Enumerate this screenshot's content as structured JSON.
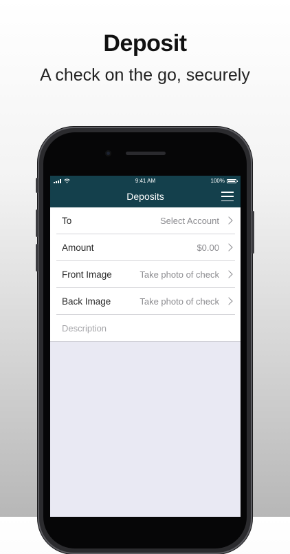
{
  "promo": {
    "heading": "Deposit",
    "subheading": "A check on the go, securely"
  },
  "status_bar": {
    "time": "9:41 AM",
    "battery": "100%",
    "signal_icon": "cellular-signal-icon",
    "wifi_icon": "wifi-icon",
    "battery_icon": "battery-icon"
  },
  "nav": {
    "title": "Deposits",
    "menu_icon": "hamburger-menu-icon"
  },
  "form": {
    "to": {
      "label": "To",
      "value": "Select Account"
    },
    "amount": {
      "label": "Amount",
      "value": "$0.00"
    },
    "front_image": {
      "label": "Front Image",
      "value": "Take photo of check"
    },
    "back_image": {
      "label": "Back Image",
      "value": "Take photo of check"
    },
    "description": {
      "placeholder": "Description",
      "value": ""
    }
  },
  "colors": {
    "header_background": "#14404c",
    "screen_background": "#e9e9f3",
    "value_text": "#8b8b8f"
  }
}
